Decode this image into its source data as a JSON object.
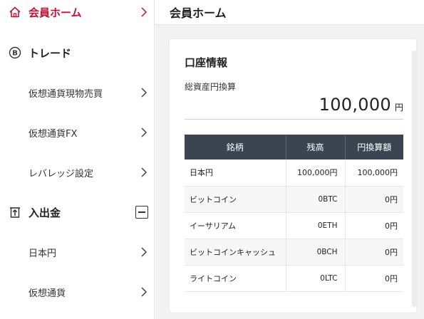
{
  "sidebar": {
    "items": [
      {
        "label": "会員ホーム",
        "icon": "home-icon",
        "active": true
      },
      {
        "label": "トレード",
        "icon": "bitcoin-icon"
      },
      {
        "label": "仮想通貨現物売買"
      },
      {
        "label": "仮想通貨FX"
      },
      {
        "label": "レバレッジ設定"
      },
      {
        "label": "入出金",
        "icon": "deposit-withdraw-icon",
        "toggle": "collapse"
      },
      {
        "label": "日本円"
      },
      {
        "label": "仮想通貨"
      }
    ]
  },
  "header": {
    "title": "会員ホーム"
  },
  "account": {
    "title": "口座情報",
    "total_label": "総資産円換算",
    "total_value": "100,000",
    "total_unit": "円",
    "table": {
      "headers": [
        "銘柄",
        "残高",
        "円換算額"
      ],
      "rows": [
        [
          "日本円",
          "100,000円",
          "100,000円"
        ],
        [
          "ビットコイン",
          "0BTC",
          "0円"
        ],
        [
          "イーサリアム",
          "0ETH",
          "0円"
        ],
        [
          "ビットコインキャッシュ",
          "0BCH",
          "0円"
        ],
        [
          "ライトコイン",
          "0LTC",
          "0円"
        ]
      ]
    }
  },
  "colors": {
    "accent": "#c8102e",
    "table_header": "#3b4552",
    "main_bg": "#f2f2f2"
  }
}
